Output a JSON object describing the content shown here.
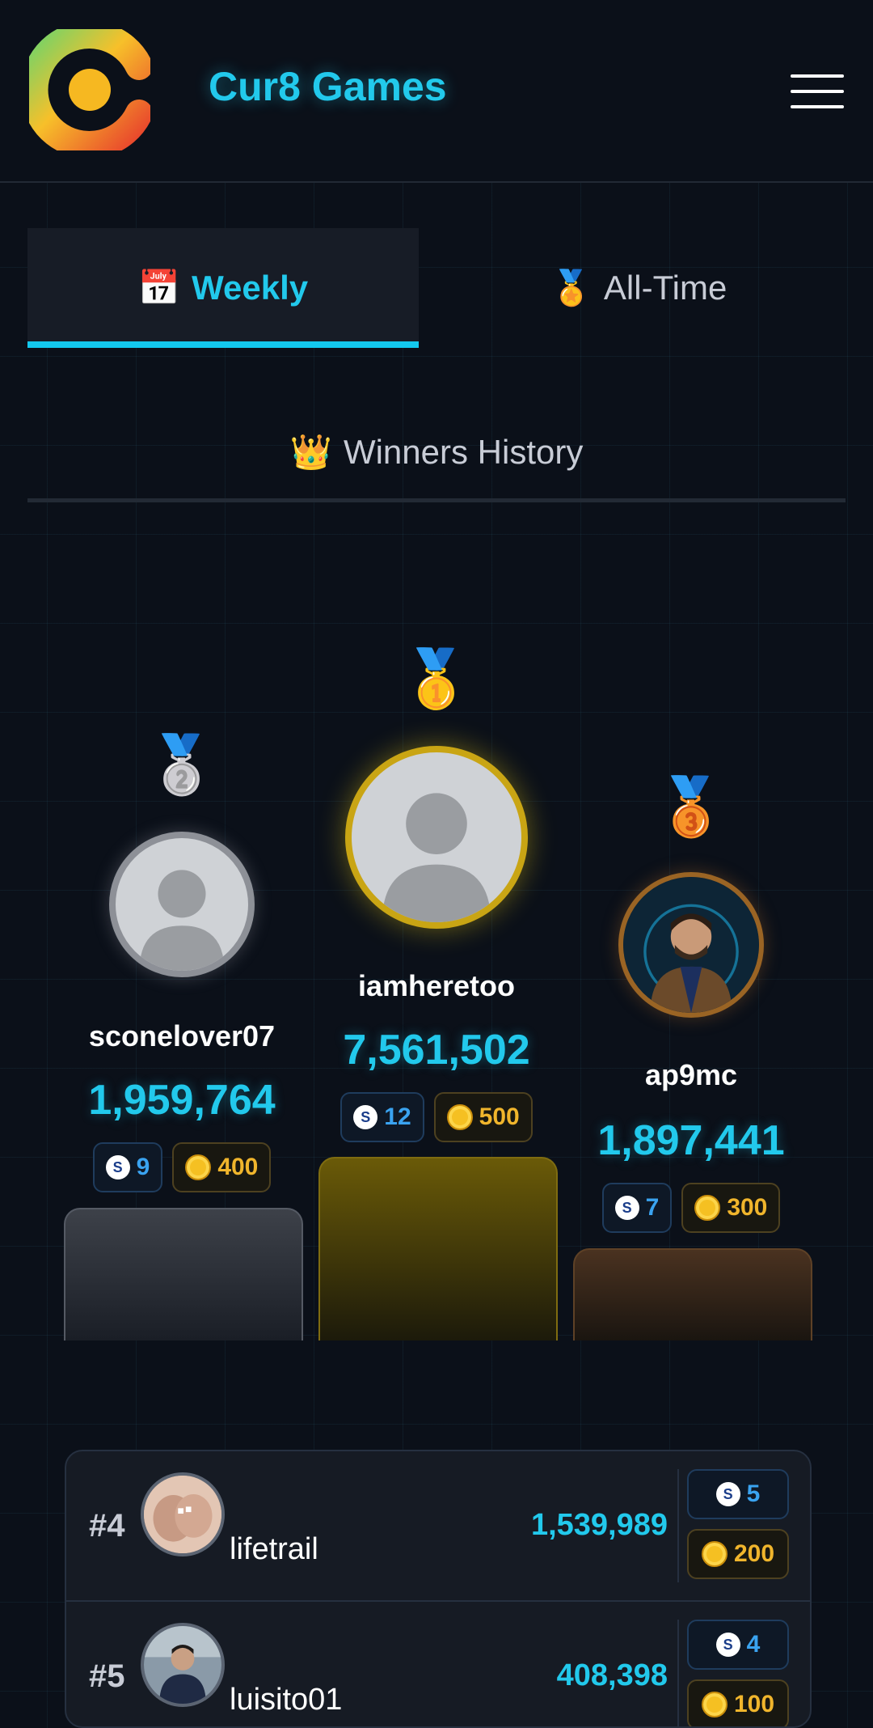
{
  "header": {
    "brand": "Cur8 Games",
    "logo_icon": "cur8-logo",
    "menu_icon": "hamburger-menu-icon"
  },
  "tabs": [
    {
      "emoji": "📅",
      "label": "Weekly",
      "active": true
    },
    {
      "emoji": "🏅",
      "label": "All-Time",
      "active": false
    }
  ],
  "winners_history": {
    "emoji": "👑",
    "label": "Winners History"
  },
  "podium": {
    "first": {
      "medal": "🥇",
      "username": "iamheretoo",
      "score": "7,561,502",
      "steem": "12",
      "coins": "500"
    },
    "second": {
      "medal": "🥈",
      "username": "sconelover07",
      "score": "1,959,764",
      "steem": "9",
      "coins": "400"
    },
    "third": {
      "medal": "🥉",
      "username": "ap9mc",
      "score": "1,897,441",
      "steem": "7",
      "coins": "300"
    }
  },
  "leaderboard": [
    {
      "rank": "#4",
      "username": "lifetrail",
      "score": "1,539,989",
      "steem": "5",
      "coins": "200"
    },
    {
      "rank": "#5",
      "username": "luisito01",
      "score": "408,398",
      "steem": "4",
      "coins": "100"
    }
  ],
  "colors": {
    "accent": "#22c9ec",
    "gold": "#f0b52c",
    "steem": "#3aa3f0",
    "background": "#0b1019"
  }
}
